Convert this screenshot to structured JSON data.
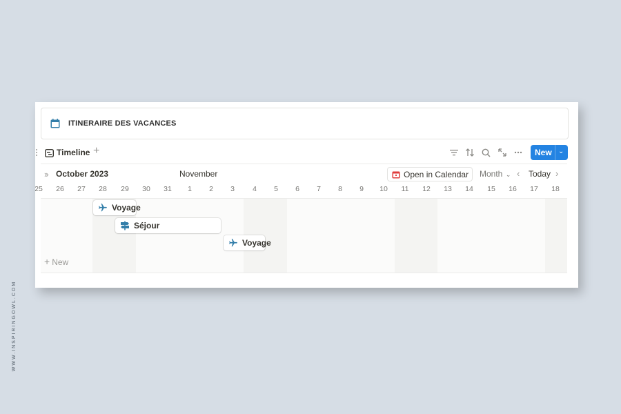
{
  "watermark": "WWW.INSPIRINGOWL.COM",
  "database": {
    "title": "ITINERAIRE DES VACANCES",
    "icon": "calendar-icon"
  },
  "view": {
    "label": "Timeline",
    "add": "+",
    "new_button": "New"
  },
  "timeline": {
    "month_left": "October 2023",
    "month_right": "November",
    "open_calendar": "Open in Calendar",
    "zoom": "Month",
    "today": "Today",
    "days": [
      "25",
      "26",
      "27",
      "28",
      "29",
      "30",
      "31",
      "1",
      "2",
      "3",
      "4",
      "5",
      "6",
      "7",
      "8",
      "9",
      "10",
      "11",
      "12",
      "13",
      "14",
      "15",
      "16",
      "17",
      "18"
    ],
    "events": [
      {
        "label": "Voyage",
        "icon": "airplane-icon"
      },
      {
        "label": "Séjour",
        "icon": "signpost-icon"
      },
      {
        "label": "Voyage",
        "icon": "airplane-icon"
      }
    ],
    "new_row": "New"
  },
  "colors": {
    "accent": "#2383e2",
    "icon_blue": "#337ea9",
    "calendar_red": "#e03e3e",
    "background": "#d6dde5"
  }
}
